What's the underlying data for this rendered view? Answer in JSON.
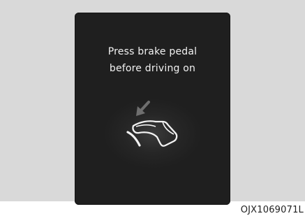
{
  "display": {
    "message_line1": "Press brake pedal",
    "message_line2": "before driving on",
    "icon": "brake-pedal-foot-icon"
  },
  "figure_code": "OJX1069071L",
  "colors": {
    "background": "#d9d9d9",
    "screen": "#262626",
    "text": "#f2f2f2",
    "icon_arrow": "#6f6f6f",
    "icon_stroke": "#f2f2f2"
  }
}
